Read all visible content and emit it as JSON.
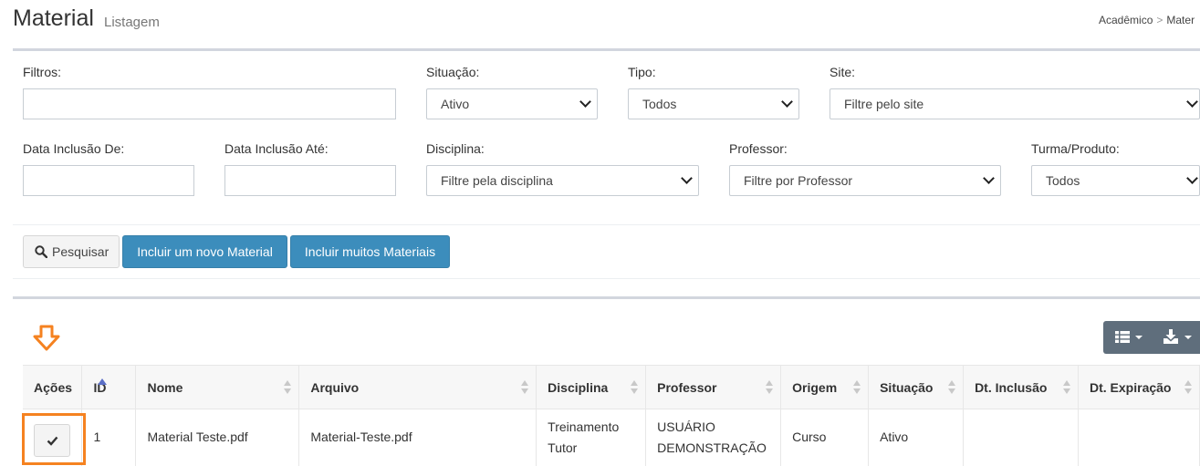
{
  "header": {
    "title": "Material",
    "subtitle": "Listagem",
    "breadcrumb": [
      "Acadêmico",
      "Mater"
    ]
  },
  "filters": {
    "filtros_label": "Filtros:",
    "situacao_label": "Situação:",
    "situacao_value": "Ativo",
    "tipo_label": "Tipo:",
    "tipo_value": "Todos",
    "site_label": "Site:",
    "site_placeholder": "Filtre pelo site",
    "data_de_label": "Data Inclusão De:",
    "data_ate_label": "Data Inclusão Até:",
    "disciplina_label": "Disciplina:",
    "disciplina_placeholder": "Filtre pela disciplina",
    "professor_label": "Professor:",
    "professor_placeholder": "Filtre por Professor",
    "turma_label": "Turma/Produto:",
    "turma_value": "Todos"
  },
  "buttons": {
    "search": "Pesquisar",
    "new_material": "Incluir um novo Material",
    "many_materials": "Incluir muitos Materiais"
  },
  "colors": {
    "primary": "#3c8dbc",
    "highlight": "#f58220",
    "toolbar": "#5f6e7c"
  },
  "table": {
    "columns": [
      "Ações",
      "ID",
      "Nome",
      "Arquivo",
      "Disciplina",
      "Professor",
      "Origem",
      "Situação",
      "Dt. Inclusão",
      "Dt. Expiração"
    ],
    "rows": [
      {
        "id": "1",
        "nome": "Material Teste.pdf",
        "arquivo": "Material-Teste.pdf",
        "disciplina_1": "Treinamento",
        "disciplina_2": "Tutor",
        "professor_1": "USUÁRIO",
        "professor_2": "DEMONSTRAÇÃO",
        "origem": "Curso",
        "situacao": "Ativo",
        "dt_inclusao": "",
        "dt_expiracao": ""
      }
    ]
  }
}
